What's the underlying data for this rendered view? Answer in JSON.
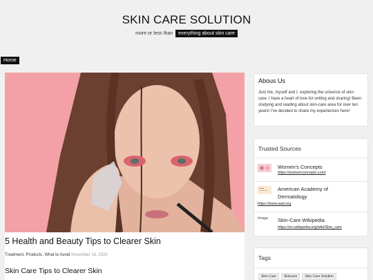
{
  "header": {
    "title": "SKIN CARE SOLUTION",
    "tagline_prefix": "more or less than",
    "tagline_highlight": "everything about skin care"
  },
  "nav": {
    "home": "Home"
  },
  "post": {
    "title": "5 Health and Beauty Tips to Clearer Skin",
    "categories": "Treatment, Products, What to Avoid",
    "date": "November 18, 2020",
    "subheading": "Skin Care Tips to Clearer Skin"
  },
  "sidebar": {
    "about": {
      "title": "Abous Us",
      "text": "Just me, myself and I, exploring the universe of skin-care. I have a heart of love for writing and sharing! Been studying and reading about skin-care area for over ten years! I've decided to share my experiences here!"
    },
    "trusted": {
      "title": "Trusted Sources",
      "items": [
        {
          "name": "Women's Concepts",
          "url": "https://womenconcepts.com/"
        },
        {
          "name": "American Academy of Dermatology",
          "url": "https://www.aad.org"
        },
        {
          "name": "Skin-Care Wikipedia",
          "url": "https://en.wikipedia.org/wiki/Skin_care",
          "img_alt": "Image"
        }
      ]
    },
    "tags": {
      "title": "Tags",
      "items": [
        "Skin Care",
        "Skincare",
        "Skin Care Solution"
      ]
    }
  },
  "colors": {
    "accent": "#111111",
    "page_bg": "#f0f0f0",
    "image_bg": "#f3a0a6"
  }
}
